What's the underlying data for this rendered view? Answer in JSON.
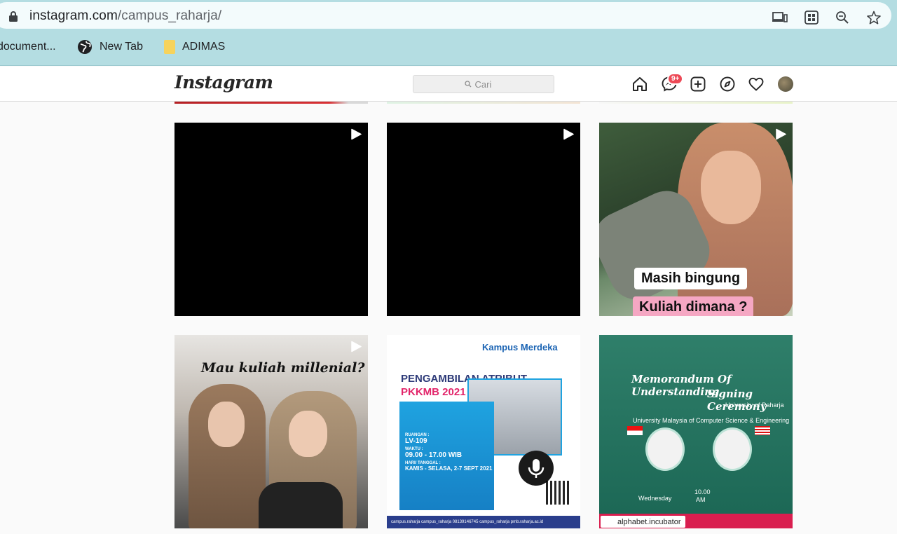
{
  "browser": {
    "url_host": "instagram.com",
    "url_path": "/campus_raharja/",
    "bookmarks": [
      {
        "label": "document...",
        "icon": "document-icon"
      },
      {
        "label": "New Tab",
        "icon": "globe-icon"
      },
      {
        "label": "ADIMAS",
        "icon": "folder-icon"
      }
    ]
  },
  "header": {
    "logo": "Instagram",
    "search_placeholder": "Cari",
    "messages_badge": "9+"
  },
  "posts": {
    "p3": {
      "caption1": "Masih bingung",
      "caption2": "Kuliah dimana ?"
    },
    "p4": {
      "title": "Mau kuliah millenial?"
    },
    "p5": {
      "brand": "Kampus Merdeka",
      "title1": "PENGAMBILAN ATRIBUT",
      "title2": "PKKMB 2021",
      "room_label": "RUANGAN :",
      "room": "LV-109",
      "time_label": "WAKTU :",
      "time": "09.00 - 17.00 WIB",
      "date_label": "HARI/ TANGGAL :",
      "date": "KAMIS - SELASA, 2-7 SEPT 2021",
      "footer": "campus.raharja   campus_raharja   08139146745   campus_raharja   pmb.raharja.ac.id"
    },
    "p6": {
      "title1": "Memorandum Of Understanding",
      "title2": "Signing Ceremony",
      "org1": "University of Raharja",
      "org2": "University Malaysia of Computer Science & Engineering",
      "day": "Wednesday",
      "time": "10.00",
      "ampm": "AM",
      "tagged": "alphabet.incubator"
    }
  },
  "colors": {
    "badge": "#ed4956",
    "chrome": "#b4dde2"
  }
}
